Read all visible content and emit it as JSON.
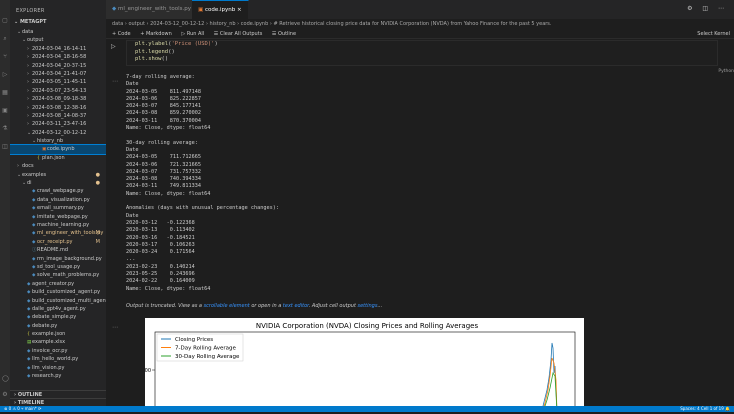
{
  "sidebar": {
    "title": "EXPLORER",
    "section": "METAGPT",
    "tree": [
      {
        "label": "data",
        "chev": "⌄",
        "indent": 1
      },
      {
        "label": "output",
        "chev": "⌄",
        "indent": 2
      },
      {
        "label": "2024-03-04_16-14-11",
        "chev": "›",
        "indent": 3
      },
      {
        "label": "2024-03-04_18-16-58",
        "chev": "›",
        "indent": 3
      },
      {
        "label": "2024-03-04_20-37-15",
        "chev": "›",
        "indent": 3
      },
      {
        "label": "2024-03-04_21-41-07",
        "chev": "›",
        "indent": 3
      },
      {
        "label": "2024-03-05_11-45-11",
        "chev": "›",
        "indent": 3
      },
      {
        "label": "2024-03-07_23-54-13",
        "chev": "›",
        "indent": 3
      },
      {
        "label": "2024-03-08_09-18-38",
        "chev": "›",
        "indent": 3
      },
      {
        "label": "2024-03-08_12-38-16",
        "chev": "›",
        "indent": 3
      },
      {
        "label": "2024-03-08_14-08-37",
        "chev": "›",
        "indent": 3
      },
      {
        "label": "2024-03-11_23-47-16",
        "chev": "›",
        "indent": 3
      },
      {
        "label": "2024-03-12_00-12-12",
        "chev": "⌄",
        "indent": 3
      },
      {
        "label": "history_nb",
        "chev": "⌄",
        "indent": 4
      },
      {
        "label": "code.ipynb",
        "chev": "",
        "indent": 5,
        "selected": true,
        "icon": "notebook-icon"
      },
      {
        "label": "plan.json",
        "chev": "",
        "indent": 4,
        "icon": "json-icon"
      },
      {
        "label": "docs",
        "chev": "›",
        "indent": 1
      },
      {
        "label": "examples",
        "chev": "⌄",
        "indent": 1,
        "mod": "●"
      },
      {
        "label": "di",
        "chev": "⌄",
        "indent": 2,
        "mod": "●"
      },
      {
        "label": "crawl_webpage.py",
        "chev": "",
        "indent": 3,
        "icon": "python-icon"
      },
      {
        "label": "data_visualization.py",
        "chev": "",
        "indent": 3,
        "icon": "python-icon"
      },
      {
        "label": "email_summary.py",
        "chev": "",
        "indent": 3,
        "icon": "python-icon"
      },
      {
        "label": "imitate_webpage.py",
        "chev": "",
        "indent": 3,
        "icon": "python-icon"
      },
      {
        "label": "machine_learning.py",
        "chev": "",
        "indent": 3,
        "icon": "python-icon"
      },
      {
        "label": "ml_engineer_with_tools.py",
        "chev": "",
        "indent": 3,
        "icon": "python-icon",
        "mod": "M"
      },
      {
        "label": "ocr_receipt.py",
        "chev": "",
        "indent": 3,
        "icon": "python-icon",
        "mod": "M"
      },
      {
        "label": "README.md",
        "chev": "",
        "indent": 3,
        "icon": "info-icon"
      },
      {
        "label": "rm_image_background.py",
        "chev": "",
        "indent": 3,
        "icon": "python-icon"
      },
      {
        "label": "sd_tool_usage.py",
        "chev": "",
        "indent": 3,
        "icon": "python-icon"
      },
      {
        "label": "solve_math_problems.py",
        "chev": "",
        "indent": 3,
        "icon": "python-icon"
      },
      {
        "label": "agent_creator.py",
        "chev": "",
        "indent": 2,
        "icon": "python-icon"
      },
      {
        "label": "build_customized_agent.py",
        "chev": "",
        "indent": 2,
        "icon": "python-icon"
      },
      {
        "label": "build_customized_multi_agents.py",
        "chev": "",
        "indent": 2,
        "icon": "python-icon"
      },
      {
        "label": "dalle_gpt4v_agent.py",
        "chev": "",
        "indent": 2,
        "icon": "python-icon"
      },
      {
        "label": "debate_simple.py",
        "chev": "",
        "indent": 2,
        "icon": "python-icon"
      },
      {
        "label": "debate.py",
        "chev": "",
        "indent": 2,
        "icon": "python-icon"
      },
      {
        "label": "example.json",
        "chev": "",
        "indent": 2,
        "icon": "json-icon"
      },
      {
        "label": "example.xlsx",
        "chev": "",
        "indent": 2,
        "icon": "file-icon"
      },
      {
        "label": "invoice_ocr.py",
        "chev": "",
        "indent": 2,
        "icon": "python-icon"
      },
      {
        "label": "llm_hello_world.py",
        "chev": "",
        "indent": 2,
        "icon": "python-icon"
      },
      {
        "label": "llm_vision.py",
        "chev": "",
        "indent": 2,
        "icon": "python-icon"
      },
      {
        "label": "research.py",
        "chev": "",
        "indent": 2,
        "icon": "python-icon"
      }
    ],
    "outline": "OUTLINE",
    "timeline": "TIMELINE"
  },
  "tabs": [
    {
      "label": "ml_engineer_with_tools.py M",
      "active": false
    },
    {
      "label": "code.ipynb ×",
      "active": true
    }
  ],
  "breadcrumb": "data › output › 2024-03-12_00-12-12 › history_nb › code.ipynb › # Retrieve historical closing price data for NVIDIA Corporation (NVDA) from Yahoo Finance for the past 5 years.",
  "toolbar": {
    "code": "+ Code",
    "markdown": "+ Markdown",
    "run_all": "▷ Run All",
    "clear": "☰ Clear All Outputs",
    "outline": "☰ Outline",
    "kernel": "Select Kernel"
  },
  "code_lines": [
    {
      "fn": "plt.ylabel",
      "arg": "'Price (USD)'"
    },
    {
      "fn": "plt.legend",
      "arg": ""
    },
    {
      "fn": "plt.show",
      "arg": ""
    }
  ],
  "cell_language": "Python",
  "output_lines": [
    "7-day rolling average:",
    "Date",
    "2024-03-05    811.497148",
    "2024-03-06    825.222857",
    "2024-03-07    845.177141",
    "2024-03-08    859.270002",
    "2024-03-11    870.370004",
    "Name: Close, dtype: float64",
    "",
    "30-day rolling average:",
    "Date",
    "2024-03-05    711.712665",
    "2024-03-06    721.321665",
    "2024-03-07    731.757332",
    "2024-03-08    740.394334",
    "2024-03-11    749.811334",
    "Name: Close, dtype: float64",
    "",
    "Anomalies (days with unusual percentage changes):",
    "Date",
    "2020-03-12   -0.122368",
    "2020-03-13    0.113402",
    "2020-03-16   -0.184521",
    "2020-03-17    0.106263",
    "2020-03-24    0.171564",
    "...",
    "2023-02-23    0.140214",
    "2023-05-25    0.243696",
    "2024-02-22    0.164009",
    "Name: Close, dtype: float64"
  ],
  "truncated": {
    "prefix": "Output is truncated. View as a ",
    "link1": "scrollable element",
    "middle": " or open in a ",
    "link2": "text editor",
    "middle2": ". Adjust cell output ",
    "link3": "settings",
    "suffix": "..."
  },
  "chart_data": {
    "type": "line",
    "title": "NVIDIA Corporation (NVDA) Closing Prices and Rolling Averages",
    "series": [
      {
        "name": "Closing Prices",
        "color": "#1f77b4"
      },
      {
        "name": "7-Day Rolling Average",
        "color": "#ff7f0e"
      },
      {
        "name": "30-Day Rolling Average",
        "color": "#2ca02c"
      }
    ],
    "yticks": [
      "800"
    ],
    "legend": "top-left"
  },
  "statusbar": {
    "left": "⊗ 0  ⚠ 0   ⑂ main*   ⟳",
    "right": "Spaces: 4   Cell 1 of 19   🔔"
  }
}
